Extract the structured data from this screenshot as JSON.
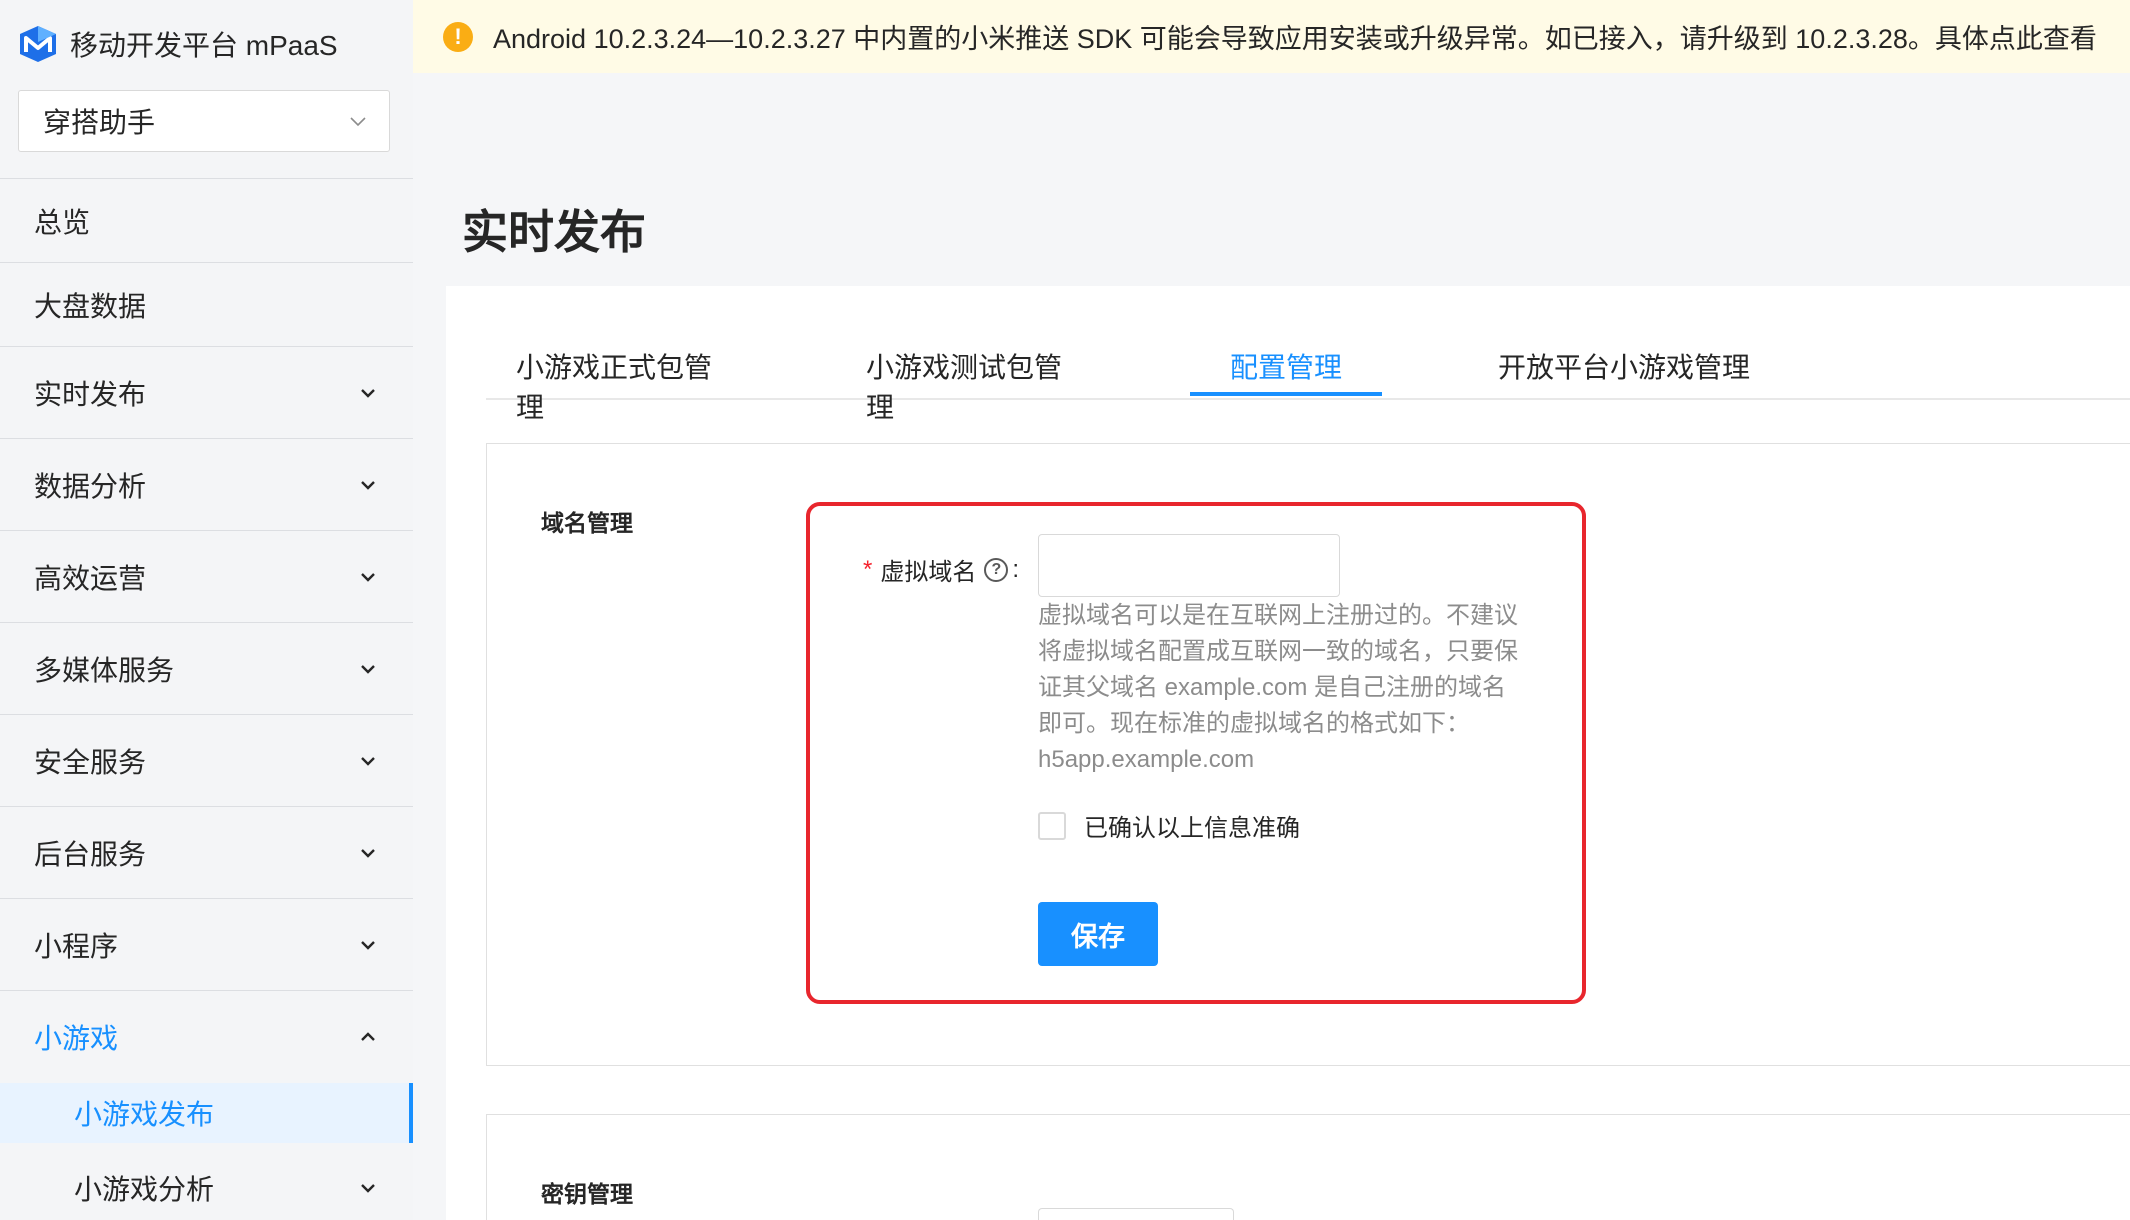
{
  "brand": {
    "name": "移动开发平台 mPaaS",
    "logo_icon": "mpaas-logo-icon"
  },
  "app_select": {
    "value": "穿搭助手"
  },
  "sidebar": {
    "items": [
      {
        "label": "总览",
        "expandable": false
      },
      {
        "label": "大盘数据",
        "expandable": false
      },
      {
        "label": "实时发布",
        "expandable": true
      },
      {
        "label": "数据分析",
        "expandable": true
      },
      {
        "label": "高效运营",
        "expandable": true
      },
      {
        "label": "多媒体服务",
        "expandable": true
      },
      {
        "label": "安全服务",
        "expandable": true
      },
      {
        "label": "后台服务",
        "expandable": true
      },
      {
        "label": "小程序",
        "expandable": true
      },
      {
        "label": "小游戏",
        "expandable": true,
        "open": true
      }
    ],
    "sub_items": [
      {
        "label": "小游戏发布",
        "active": true
      },
      {
        "label": "小游戏分析",
        "expandable": true
      }
    ]
  },
  "notice": {
    "text": "Android 10.2.3.24—10.2.3.27 中内置的小米推送 SDK 可能会导致应用安装或升级异常。如已接入，请升级到 10.2.3.28。具体点此查看"
  },
  "page": {
    "title": "实时发布"
  },
  "tabs": [
    {
      "label": "小游戏正式包管理"
    },
    {
      "label": "小游戏测试包管理"
    },
    {
      "label": "配置管理",
      "active": true
    },
    {
      "label": "开放平台小游戏管理"
    }
  ],
  "domain_section": {
    "title": "域名管理",
    "field_label": "虚拟域名",
    "required_mark": "*",
    "colon": ":",
    "input_value": "",
    "help_lines": [
      "虚拟域名可以是在互联网上注册过的。不建议",
      "将虚拟域名配置成互联网一致的域名，只要保",
      "证其父域名 example.com 是自己注册的域名",
      "即可。现在标准的虚拟域名的格式如下：",
      "h5app.example.com"
    ],
    "confirm_label": "已确认以上信息准确",
    "save_label": "保存"
  },
  "key_section": {
    "title": "密钥管理"
  },
  "colors": {
    "accent": "#1890ff",
    "highlight": "#e8262d",
    "warning": "#faad14",
    "notice_bg": "#fffbe6"
  }
}
